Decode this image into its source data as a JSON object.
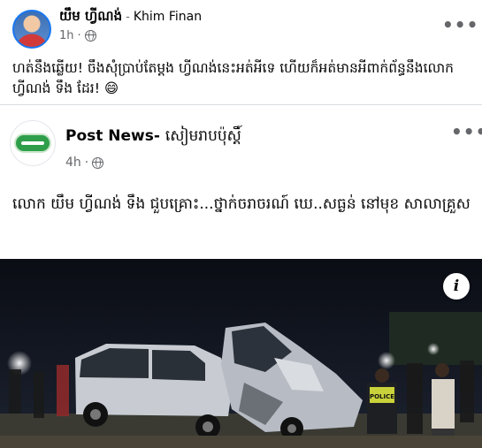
{
  "post": {
    "author_khmer": "យឹម ហ្វីណង់",
    "author_separator": "-",
    "author_latin": "Khim Finan",
    "time": "1h",
    "privacy_icon": "globe-icon",
    "more_label": "•••",
    "caption": "ហត់នឹងឆ្លើយ! ចឹងសុំប្រាប់តែម្តង ហ្វីណង់នេះអត់អីទេ ហើយក៏អត់មានអីពាក់ព័ន្ធនឹងលោក ហ្វីណង់ ទឹង ដែរ! 😄"
  },
  "shared_post": {
    "page_name_latin": "Post News-",
    "page_name_khmer": "សៀមរាបប៉ុស្តិ៍",
    "time": "4h",
    "privacy_icon": "globe-icon",
    "more_label": "•••",
    "body": "លោក យឹម ហ្វីណង់ ទឹង ជួបគ្រោះ...ថ្នាក់ចរាចរណ៍ ឃេ..សធ្ងន់ នៅមុខ សាលាគ្រួស",
    "photo_info_label": "i",
    "photo_overlay_text": "POLICE"
  },
  "colors": {
    "secondary_text": "#65676b",
    "primary_text": "#050505",
    "accent": "#1877f2"
  }
}
